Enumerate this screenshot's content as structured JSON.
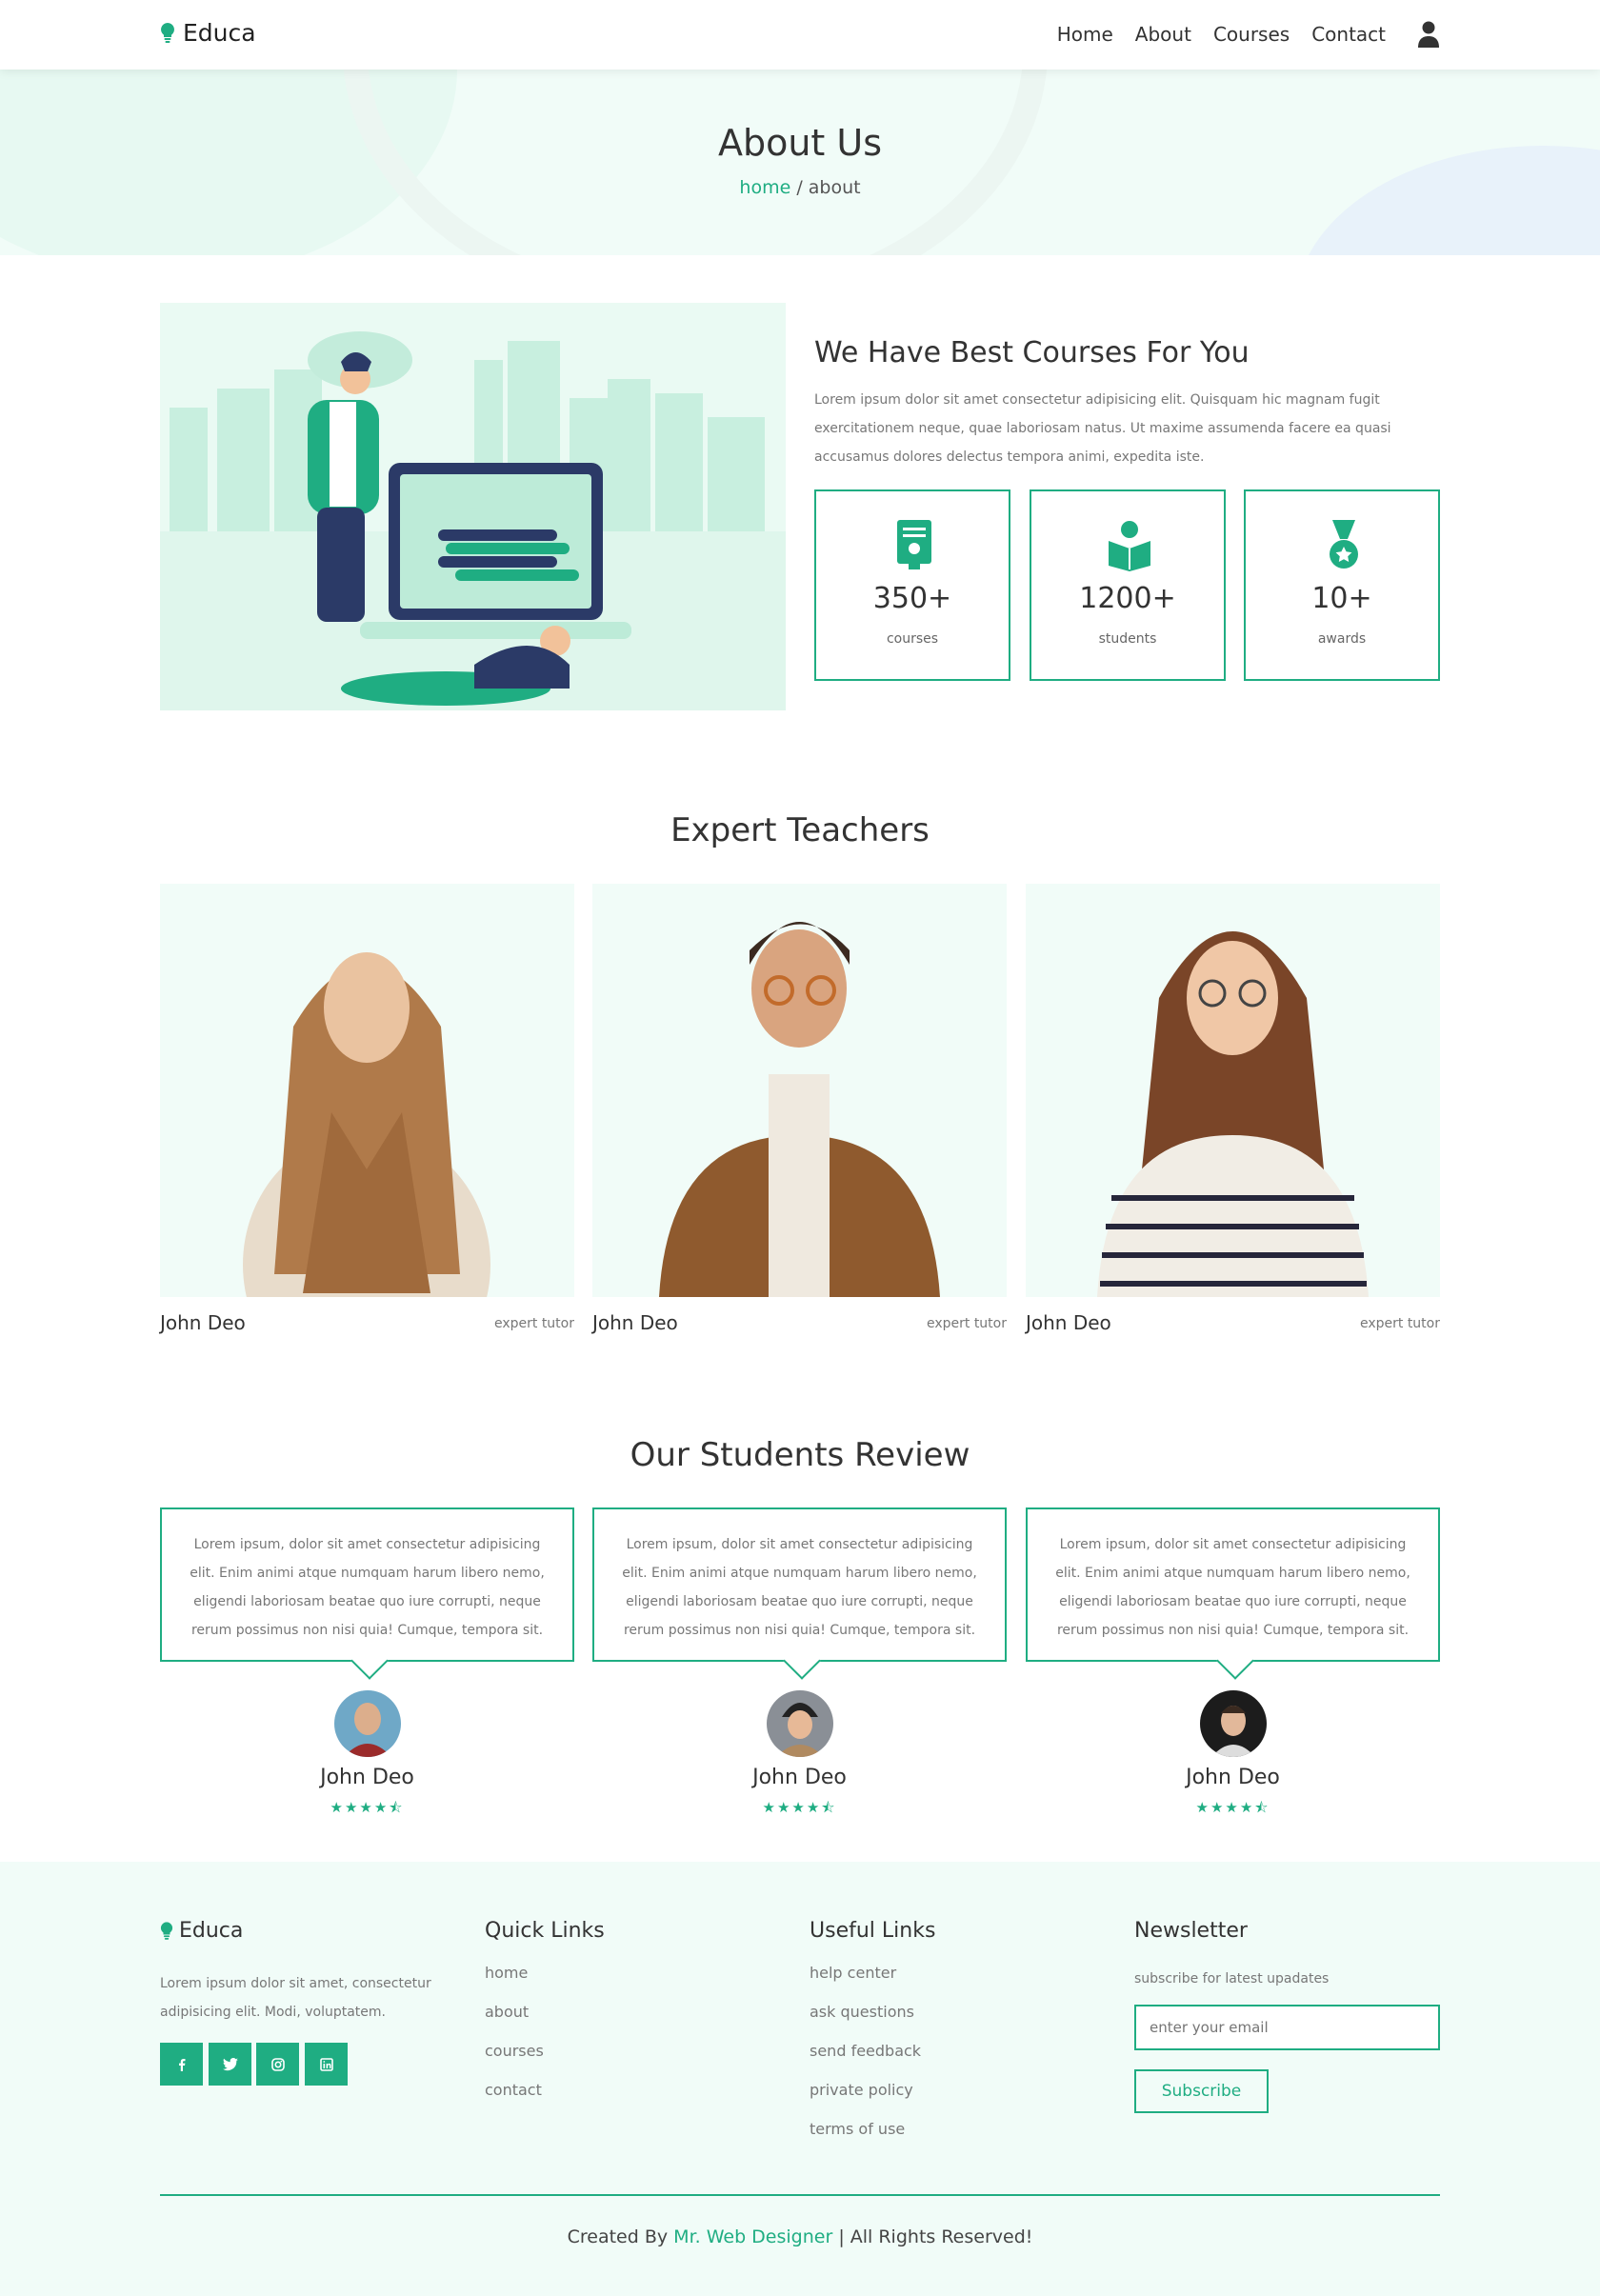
{
  "brand": {
    "name": "Educa",
    "accent": "#1fad82"
  },
  "nav": {
    "items": [
      "Home",
      "About",
      "Courses",
      "Contact"
    ],
    "user_icon": "user-icon"
  },
  "banner": {
    "title": "About Us",
    "crumb_home": "home",
    "crumb_sep": " / ",
    "crumb_current": "about"
  },
  "about": {
    "title": "We Have Best Courses For You",
    "text": "Lorem ipsum dolor sit amet consectetur adipisicing elit. Quisquam hic magnam fugit exercitationem neque, quae laboriosam natus. Ut maxime assumenda facere ea quasi accusamus dolores delectus tempora animi, expedita iste.",
    "stats": [
      {
        "icon": "certificate-icon",
        "value": "350+",
        "label": "courses"
      },
      {
        "icon": "student-reading-icon",
        "value": "1200+",
        "label": "students"
      },
      {
        "icon": "award-medal-icon",
        "value": "10+",
        "label": "awards"
      }
    ]
  },
  "teachers": {
    "title": "Expert Teachers",
    "items": [
      {
        "name": "John Deo",
        "role": "expert tutor"
      },
      {
        "name": "John Deo",
        "role": "expert tutor"
      },
      {
        "name": "John Deo",
        "role": "expert tutor"
      }
    ]
  },
  "reviews": {
    "title": "Our Students Review",
    "items": [
      {
        "text": "Lorem ipsum, dolor sit amet consectetur adipisicing elit. Enim animi atque numquam harum libero nemo, eligendi laboriosam beatae quo iure corrupti, neque rerum possimus non nisi quia! Cumque, tempora sit.",
        "name": "John Deo",
        "stars": "★★★★⯪"
      },
      {
        "text": "Lorem ipsum, dolor sit amet consectetur adipisicing elit. Enim animi atque numquam harum libero nemo, eligendi laboriosam beatae quo iure corrupti, neque rerum possimus non nisi quia! Cumque, tempora sit.",
        "name": "John Deo",
        "stars": "★★★★⯪"
      },
      {
        "text": "Lorem ipsum, dolor sit amet consectetur adipisicing elit. Enim animi atque numquam harum libero nemo, eligendi laboriosam beatae quo iure corrupti, neque rerum possimus non nisi quia! Cumque, tempora sit.",
        "name": "John Deo",
        "stars": "★★★★⯪"
      }
    ]
  },
  "footer": {
    "brand": "Educa",
    "text": "Lorem ipsum dolor sit amet, consectetur adipisicing elit. Modi, voluptatem.",
    "social": [
      "facebook-icon",
      "twitter-icon",
      "instagram-icon",
      "linkedin-icon"
    ],
    "quick_title": "Quick Links",
    "quick_links": [
      "home",
      "about",
      "courses",
      "contact"
    ],
    "useful_title": "Useful Links",
    "useful_links": [
      "help center",
      "ask questions",
      "send feedback",
      "private policy",
      "terms of use"
    ],
    "newsletter_title": "Newsletter",
    "newsletter_sub": "subscribe for latest upadates",
    "email_placeholder": "enter your email",
    "subscribe": "Subscribe",
    "credit_pre": "Created By ",
    "credit_author": "Mr. Web Designer",
    "credit_post": " | All Rights Reserved!"
  }
}
